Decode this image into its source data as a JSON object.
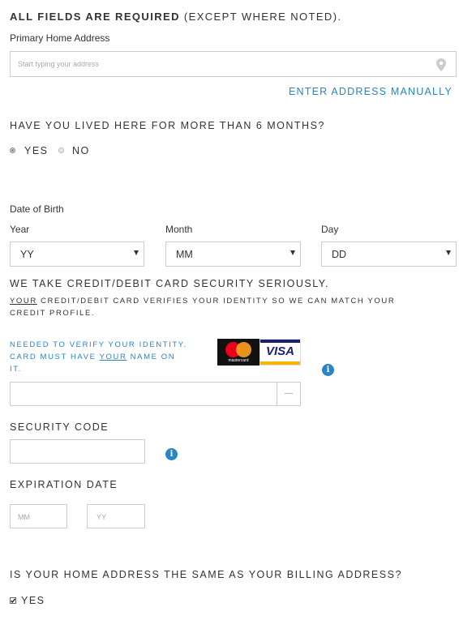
{
  "header": {
    "title_bold": "ALL FIELDS ARE REQUIRED",
    "title_rest": " (EXCEPT WHERE NOTED)."
  },
  "address": {
    "label": "Primary Home Address",
    "placeholder": "Start typing your address",
    "manual_link": "ENTER ADDRESS MANUALLY",
    "icon": "location-pin-icon"
  },
  "residence": {
    "question": "HAVE YOU LIVED HERE FOR MORE THAN 6 MONTHS?",
    "options": [
      {
        "label": "YES",
        "selected": true
      },
      {
        "label": "NO",
        "selected": false
      }
    ]
  },
  "dob": {
    "label": "Date of Birth",
    "year_label": "Year",
    "year_value": "YY",
    "month_label": "Month",
    "month_value": "MM",
    "day_label": "Day",
    "day_value": "DD"
  },
  "card": {
    "security_heading": "WE TAKE CREDIT/DEBIT CARD SECURITY SERIOUSLY.",
    "info_line1_u": "YOUR",
    "info_line1_rest": " CREDIT/DEBIT CARD VERIFIES YOUR IDENTITY SO WE CAN MATCH YOUR",
    "info_line2": "CREDIT PROFILE.",
    "verify_line1": "NEEDED TO VERIFY YOUR IDENTITY.",
    "verify_line2_pre": "CARD MUST HAVE ",
    "verify_line2_u": "YOUR",
    "verify_line2_post": " NAME ON",
    "verify_line3": "IT.",
    "mastercard_text": "mastercard",
    "visa_text": "VISA",
    "number_suffix": "—",
    "colors": {
      "accent": "#2a84c5",
      "mc_red": "#eb001b",
      "mc_orange": "#f79e1b",
      "visa_blue": "#1a1f71",
      "visa_gold": "#f7b600"
    }
  },
  "security_code": {
    "label": "SECURITY CODE"
  },
  "expiration": {
    "label": "EXPIRATION DATE",
    "month_placeholder": "MM",
    "year_placeholder": "YY"
  },
  "billing": {
    "question": "IS YOUR HOME ADDRESS THE SAME AS YOUR BILLING ADDRESS?",
    "checkbox_label": "YES",
    "checked": true
  }
}
